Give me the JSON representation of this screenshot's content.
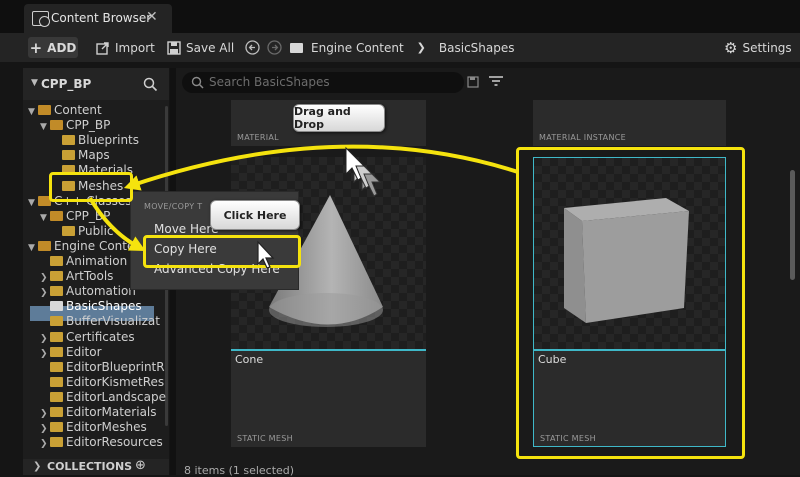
{
  "window": {
    "tab_title": "Content Browser",
    "tab_close": "✕"
  },
  "toolbar": {
    "add_label": "ADD",
    "import_label": "Import",
    "save_all_label": "Save All",
    "breadcrumb": [
      "Engine Content",
      "BasicShapes"
    ],
    "settings_label": "Settings"
  },
  "sources": {
    "title": "CPP_BP",
    "tree": [
      {
        "label": "Content",
        "depth": 0,
        "expanded": true
      },
      {
        "label": "CPP_BP",
        "depth": 1,
        "expanded": true
      },
      {
        "label": "Blueprints",
        "depth": 2
      },
      {
        "label": "Maps",
        "depth": 2
      },
      {
        "label": "Materials",
        "depth": 2
      },
      {
        "label": "Meshes",
        "depth": 2
      },
      {
        "label": "C++ Classes",
        "depth": 0,
        "expanded": true
      },
      {
        "label": "CPP_BP",
        "depth": 1,
        "expanded": true
      },
      {
        "label": "Public",
        "depth": 2
      },
      {
        "label": "Engine Content",
        "depth": 0,
        "expanded": true
      },
      {
        "label": "Animation",
        "depth": 1
      },
      {
        "label": "ArtTools",
        "depth": 1,
        "collapsed": true
      },
      {
        "label": "Automation",
        "depth": 1,
        "collapsed": true
      },
      {
        "label": "BasicShapes",
        "depth": 1,
        "selected": true
      },
      {
        "label": "BufferVisualizat",
        "depth": 1
      },
      {
        "label": "Certificates",
        "depth": 1,
        "collapsed": true
      },
      {
        "label": "Editor",
        "depth": 1,
        "collapsed": true
      },
      {
        "label": "EditorBlueprintR",
        "depth": 1
      },
      {
        "label": "EditorKismetRes",
        "depth": 1
      },
      {
        "label": "EditorLandscape",
        "depth": 1
      },
      {
        "label": "EditorMaterials",
        "depth": 1,
        "collapsed": true
      },
      {
        "label": "EditorMeshes",
        "depth": 1,
        "collapsed": true
      },
      {
        "label": "EditorResources",
        "depth": 1,
        "collapsed": true
      }
    ],
    "collections_label": "COLLECTIONS"
  },
  "search": {
    "placeholder": "Search BasicShapes"
  },
  "assets": {
    "top_left_type": "MATERIAL",
    "top_right_type": "MATERIAL INSTANCE",
    "cone_name": "Cone",
    "cone_type": "STATIC MESH",
    "cube_name": "Cube",
    "cube_type": "STATIC MESH"
  },
  "context_menu": {
    "section_title": "MOVE/COPY T",
    "items": [
      "Move Here",
      "Copy Here",
      "Advanced Copy Here"
    ]
  },
  "annotations": {
    "drag_drop": "Drag and Drop",
    "click_here": "Click Here",
    "highlight_color": "#f5e30e"
  },
  "footer": {
    "status": "8 items (1 selected)"
  }
}
